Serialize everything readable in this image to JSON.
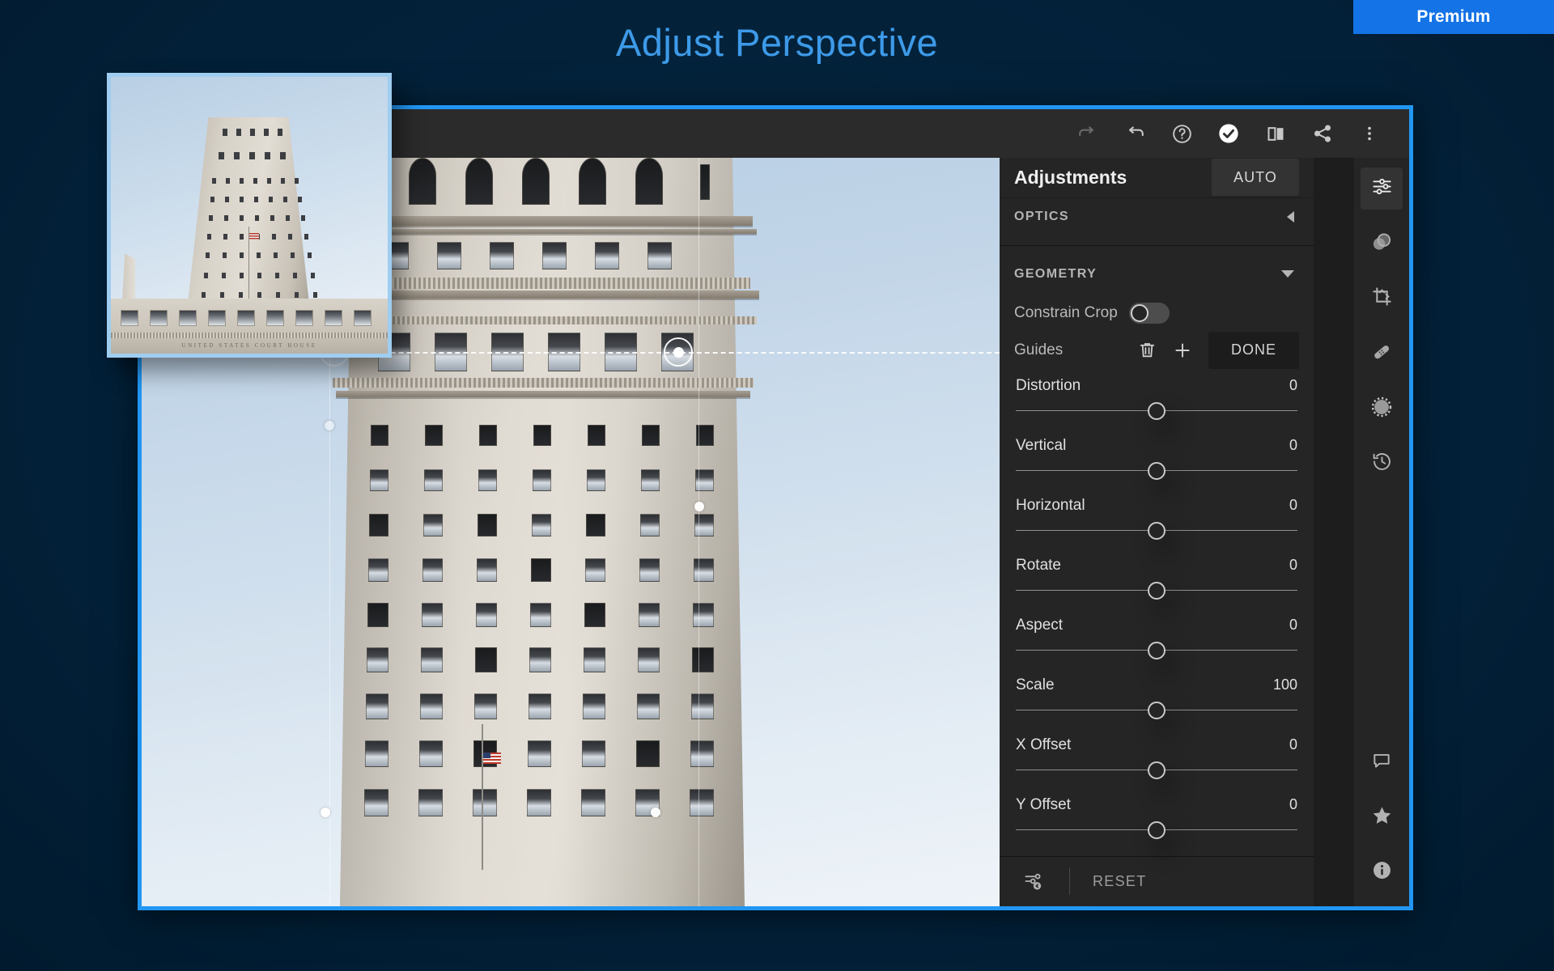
{
  "page": {
    "title": "Adjust Perspective",
    "badge": "Premium",
    "accent_blue": "#2196f3",
    "title_color": "#3d9ae8",
    "background": "#042038"
  },
  "toolbar": {
    "items": [
      {
        "name": "redo-icon",
        "label": "Redo",
        "state": "disabled"
      },
      {
        "name": "undo-icon",
        "label": "Undo",
        "state": "enabled"
      },
      {
        "name": "help-icon",
        "label": "Help",
        "state": "enabled"
      },
      {
        "name": "check-icon",
        "label": "Apply",
        "state": "active"
      },
      {
        "name": "compare-icon",
        "label": "Before / After",
        "state": "enabled"
      },
      {
        "name": "share-icon",
        "label": "Share",
        "state": "enabled"
      },
      {
        "name": "more-icon",
        "label": "More options",
        "state": "enabled"
      }
    ]
  },
  "panel": {
    "title": "Adjustments",
    "auto_label": "AUTO",
    "sections": [
      {
        "name": "optics",
        "label": "OPTICS",
        "expanded": false
      },
      {
        "name": "geometry",
        "label": "GEOMETRY",
        "expanded": true
      }
    ],
    "constrain_crop": {
      "label": "Constrain Crop",
      "value": "off"
    },
    "guides": {
      "label": "Guides",
      "delete_icon": "trash-icon",
      "add_icon": "plus-icon",
      "done_label": "DONE"
    },
    "sliders": [
      {
        "label": "Distortion",
        "value": "0",
        "pos": 50
      },
      {
        "label": "Vertical",
        "value": "0",
        "pos": 50
      },
      {
        "label": "Horizontal",
        "value": "0",
        "pos": 50
      },
      {
        "label": "Rotate",
        "value": "0",
        "pos": 50
      },
      {
        "label": "Aspect",
        "value": "0",
        "pos": 50
      },
      {
        "label": "Scale",
        "value": "100",
        "pos": 50
      },
      {
        "label": "X Offset",
        "value": "0",
        "pos": 50
      },
      {
        "label": "Y Offset",
        "value": "0",
        "pos": 50
      }
    ],
    "footer": {
      "settings_icon": "sliders-reset-icon",
      "reset_label": "RESET"
    }
  },
  "rail": {
    "top_items": [
      {
        "name": "rail-item-edit",
        "icon": "sliders-icon",
        "label": "Edit",
        "active": true
      },
      {
        "name": "rail-item-selective",
        "icon": "selective-mask-icon",
        "label": "Selective",
        "active": false
      },
      {
        "name": "rail-item-crop",
        "icon": "crop-icon",
        "label": "Crop",
        "active": false
      },
      {
        "name": "rail-item-healing",
        "icon": "healing-brush-icon",
        "label": "Healing",
        "active": false
      },
      {
        "name": "rail-item-radial",
        "icon": "radial-blur-icon",
        "label": "Radial",
        "active": false
      },
      {
        "name": "rail-item-versions",
        "icon": "history-clock-icon",
        "label": "Versions",
        "active": false
      }
    ],
    "bottom_items": [
      {
        "name": "rail-item-comments",
        "icon": "comment-bubble-icon",
        "label": "Comments"
      },
      {
        "name": "rail-item-rating",
        "icon": "star-icon",
        "label": "Rating"
      },
      {
        "name": "rail-item-info",
        "icon": "info-icon",
        "label": "Info"
      }
    ]
  },
  "canvas": {
    "photo_caption": "UNITED STATES COURT HOUSE",
    "guide_line": {
      "type": "horizontal",
      "style": "dashed",
      "color": "#ffffff"
    },
    "handles": [
      {
        "name": "guide-handle-left",
        "type": "ring"
      },
      {
        "name": "guide-handle-right",
        "type": "ring"
      },
      {
        "name": "crop-handle-left",
        "type": "dot"
      },
      {
        "name": "crop-handle-right",
        "type": "dot"
      },
      {
        "name": "crop-handle-bottom-left",
        "type": "dot"
      },
      {
        "name": "crop-handle-bottom-right",
        "type": "dot"
      }
    ]
  },
  "thumbnail": {
    "caption": "UNITED STATES COURT HOUSE",
    "border_color": "#9fcdf0"
  }
}
